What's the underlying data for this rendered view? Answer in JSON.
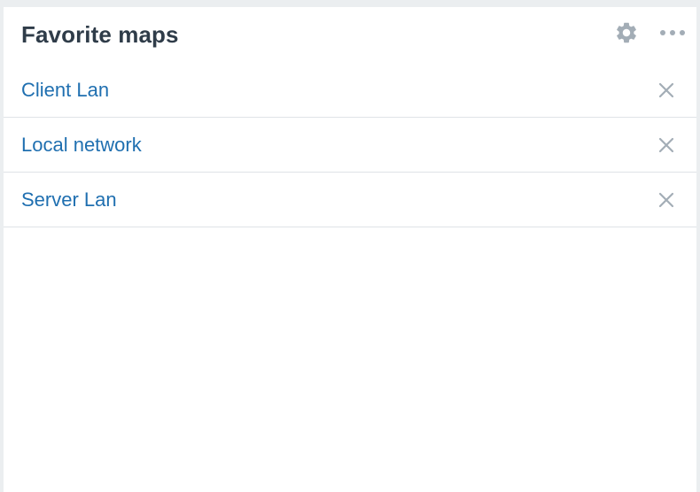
{
  "widget": {
    "title": "Favorite maps",
    "settings_icon": "gear-icon",
    "menu_icon": "more-horizontal-icon"
  },
  "favorites": [
    {
      "label": "Client Lan",
      "remove_icon": "close-icon"
    },
    {
      "label": "Local network",
      "remove_icon": "close-icon"
    },
    {
      "label": "Server Lan",
      "remove_icon": "close-icon"
    }
  ],
  "colors": {
    "title": "#2f3c49",
    "link": "#1f6fb0",
    "icon": "#a3adb6",
    "divider": "#dfe3e7"
  }
}
